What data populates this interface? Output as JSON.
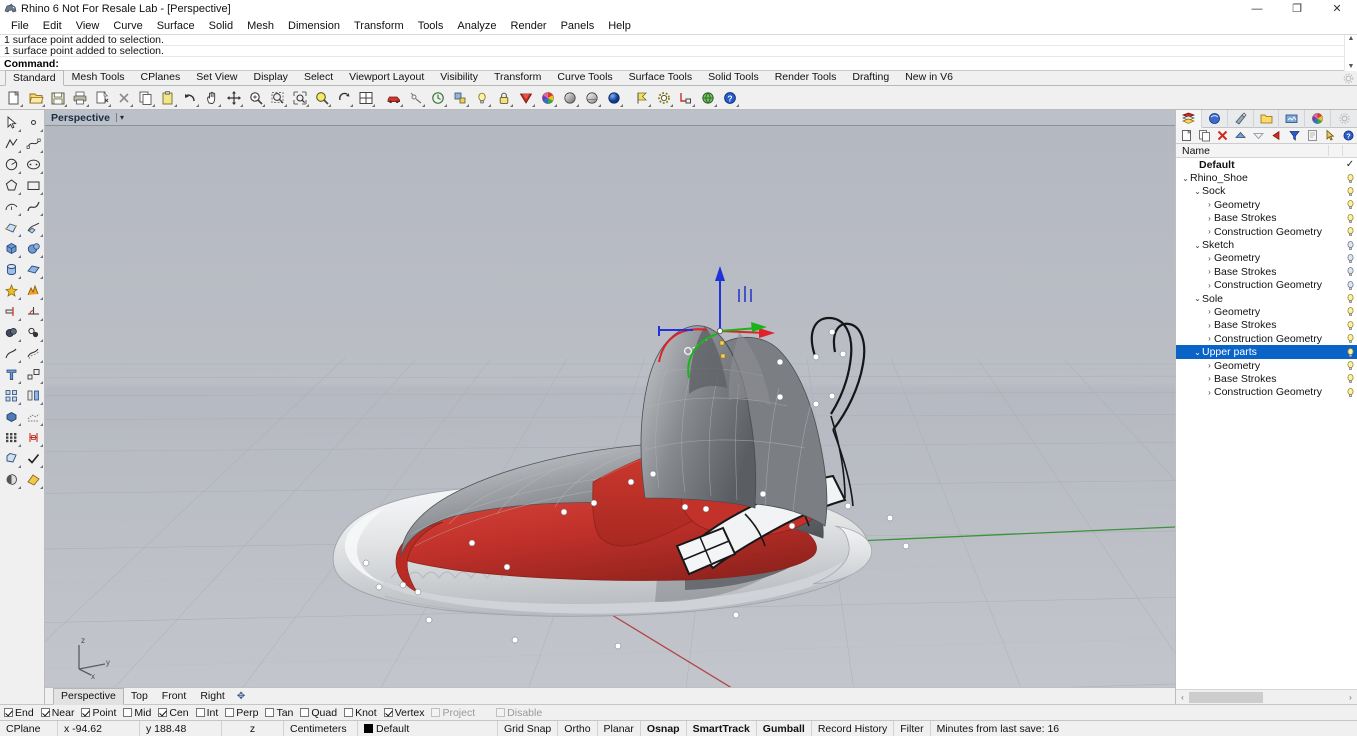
{
  "window": {
    "title": "Rhino 6 Not For Resale Lab - [Perspective]",
    "app_icon": "rhino-icon",
    "minimize": "—",
    "maximize": "❐",
    "close": "✕"
  },
  "menubar": {
    "items": [
      {
        "label": "File"
      },
      {
        "label": "Edit"
      },
      {
        "label": "View"
      },
      {
        "label": "Curve"
      },
      {
        "label": "Surface"
      },
      {
        "label": "Solid"
      },
      {
        "label": "Mesh"
      },
      {
        "label": "Dimension"
      },
      {
        "label": "Transform"
      },
      {
        "label": "Tools"
      },
      {
        "label": "Analyze"
      },
      {
        "label": "Render"
      },
      {
        "label": "Panels"
      },
      {
        "label": "Help"
      }
    ]
  },
  "command_area": {
    "history": [
      "1 surface point added to selection.",
      "1 surface point added to selection."
    ],
    "prompt": "Command:",
    "scroll_up": "▲",
    "scroll_down": "▼"
  },
  "toolbar_tabs": {
    "items": [
      {
        "label": "Standard",
        "active": true
      },
      {
        "label": "Mesh Tools",
        "active": false
      },
      {
        "label": "CPlanes",
        "active": false
      },
      {
        "label": "Set View",
        "active": false
      },
      {
        "label": "Display",
        "active": false
      },
      {
        "label": "Select",
        "active": false
      },
      {
        "label": "Viewport Layout",
        "active": false
      },
      {
        "label": "Visibility",
        "active": false
      },
      {
        "label": "Transform",
        "active": false
      },
      {
        "label": "Curve Tools",
        "active": false
      },
      {
        "label": "Surface Tools",
        "active": false
      },
      {
        "label": "Solid Tools",
        "active": false
      },
      {
        "label": "Render Tools",
        "active": false
      },
      {
        "label": "Drafting",
        "active": false
      },
      {
        "label": "New in V6",
        "active": false
      }
    ],
    "options_icon": "gear-icon"
  },
  "toolbar_icons": [
    {
      "name": "new-file-icon"
    },
    {
      "name": "open-folder-icon"
    },
    {
      "name": "save-icon"
    },
    {
      "name": "print-icon"
    },
    {
      "name": "cut-icon"
    },
    {
      "name": "delete-x-icon"
    },
    {
      "name": "copy-icon"
    },
    {
      "name": "paste-icon"
    },
    {
      "name": "undo-icon"
    },
    {
      "name": "pan-hand-icon"
    },
    {
      "name": "move-icon"
    },
    {
      "name": "zoom-icon"
    },
    {
      "name": "zoom-window-icon"
    },
    {
      "name": "zoom-extents-icon"
    },
    {
      "name": "zoom-selected-icon"
    },
    {
      "name": "rotate-view-icon"
    },
    {
      "name": "viewport-layout-icon"
    },
    {
      "name": "car-render-icon"
    },
    {
      "name": "render-preview-icon"
    },
    {
      "name": "history-icon"
    },
    {
      "name": "properties-icon"
    },
    {
      "name": "layer-bulb-icon"
    },
    {
      "name": "lock-icon"
    },
    {
      "name": "display-shade-icon"
    },
    {
      "name": "color-wheel-icon"
    },
    {
      "name": "shaded-view-icon"
    },
    {
      "name": "ghosted-view-icon"
    },
    {
      "name": "rendered-view-icon"
    },
    {
      "name": "flag-icon"
    },
    {
      "name": "options-gear-icon"
    },
    {
      "name": "named-position-icon"
    },
    {
      "name": "globe-icon"
    },
    {
      "name": "help-icon"
    }
  ],
  "left_palette": [
    {
      "name": "select-arrow-icon"
    },
    {
      "name": "point-icon"
    },
    {
      "name": "polyline-icon"
    },
    {
      "name": "control-point-curve-icon"
    },
    {
      "name": "circle-icon"
    },
    {
      "name": "ellipse-icon"
    },
    {
      "name": "polygon-icon"
    },
    {
      "name": "rectangle-icon"
    },
    {
      "name": "arc-icon"
    },
    {
      "name": "free-curve-icon"
    },
    {
      "name": "surface-from-points-icon"
    },
    {
      "name": "surface-sweep-icon"
    },
    {
      "name": "box-icon"
    },
    {
      "name": "sphere-icon"
    },
    {
      "name": "cylinder-icon"
    },
    {
      "name": "surface-plane-icon"
    },
    {
      "name": "explode-icon"
    },
    {
      "name": "boolean-split-icon"
    },
    {
      "name": "trim-icon"
    },
    {
      "name": "fillet-icon"
    },
    {
      "name": "boolean-union-icon"
    },
    {
      "name": "boolean-difference-icon"
    },
    {
      "name": "offset-curve-icon"
    },
    {
      "name": "offset-surface-icon"
    },
    {
      "name": "transform-icon"
    },
    {
      "name": "scale-icon"
    },
    {
      "name": "array-icon"
    },
    {
      "name": "mirror-icon"
    },
    {
      "name": "cap-solid-icon"
    },
    {
      "name": "mesh-icon"
    },
    {
      "name": "grid-array-icon"
    },
    {
      "name": "dimension-icon"
    },
    {
      "name": "extrude-icon"
    },
    {
      "name": "check-icon"
    },
    {
      "name": "shade-icon"
    },
    {
      "name": "render-material-icon"
    }
  ],
  "viewport": {
    "title": "Perspective",
    "dropdown_arrow": "▾",
    "axis_gizmo": {
      "x": "x",
      "y": "y",
      "z": "z"
    },
    "gumball": {
      "x_axis_color": "#e0202a",
      "y_axis_color": "#19b419",
      "z_axis_color": "#2332d8"
    },
    "background_color": "#b8bbc3",
    "model_colors": {
      "red_strap": "#c6302a",
      "grey_upper": "#8e9196",
      "white_sole": "#e8e9ea",
      "control_point": "#ffffff"
    },
    "tabs": [
      {
        "label": "Perspective",
        "active": true
      },
      {
        "label": "Top",
        "active": false
      },
      {
        "label": "Front",
        "active": false
      },
      {
        "label": "Right",
        "active": false
      }
    ],
    "add_tab": "✥"
  },
  "layer_panel": {
    "tabs": [
      {
        "name": "layers-tab",
        "active": true
      },
      {
        "name": "properties-tab",
        "active": false
      },
      {
        "name": "materials-tab",
        "active": false
      },
      {
        "name": "named-views-tab",
        "active": false
      },
      {
        "name": "display-tab",
        "active": false
      },
      {
        "name": "color-tab",
        "active": false
      },
      {
        "name": "panel-options-tab",
        "active": false
      }
    ],
    "toolbar": [
      {
        "name": "new-layer-icon"
      },
      {
        "name": "new-sublayer-icon"
      },
      {
        "name": "delete-layer-icon"
      },
      {
        "name": "move-up-icon"
      },
      {
        "name": "move-down-icon"
      },
      {
        "name": "set-current-icon"
      },
      {
        "name": "filter-icon"
      },
      {
        "name": "layer-properties-icon"
      },
      {
        "name": "select-objects-icon"
      },
      {
        "name": "layer-help-icon"
      }
    ],
    "header": {
      "name_column": "Name"
    },
    "rows": [
      {
        "label": "Default",
        "indent": 1,
        "twisty": "",
        "bold": true,
        "current": true,
        "bulb": false,
        "selected": false
      },
      {
        "label": "Rhino_Shoe",
        "indent": 0,
        "twisty": "⌄",
        "bold": false,
        "current": false,
        "bulb": true,
        "selected": false
      },
      {
        "label": "Sock",
        "indent": 1,
        "twisty": "⌄",
        "bold": false,
        "current": false,
        "bulb": true,
        "selected": false
      },
      {
        "label": "Geometry",
        "indent": 2,
        "twisty": "›",
        "bold": false,
        "current": false,
        "bulb": true,
        "selected": false
      },
      {
        "label": "Base Strokes",
        "indent": 2,
        "twisty": "›",
        "bold": false,
        "current": false,
        "bulb": true,
        "selected": false
      },
      {
        "label": "Construction Geometry",
        "indent": 2,
        "twisty": "›",
        "bold": false,
        "current": false,
        "bulb": true,
        "selected": false
      },
      {
        "label": "Sketch",
        "indent": 1,
        "twisty": "⌄",
        "bold": false,
        "current": false,
        "bulb": true,
        "selected": false
      },
      {
        "label": "Geometry",
        "indent": 2,
        "twisty": "›",
        "bold": false,
        "current": false,
        "bulb": true,
        "selected": false
      },
      {
        "label": "Base Strokes",
        "indent": 2,
        "twisty": "›",
        "bold": false,
        "current": false,
        "bulb": true,
        "selected": false
      },
      {
        "label": "Construction Geometry",
        "indent": 2,
        "twisty": "›",
        "bold": false,
        "current": false,
        "bulb": true,
        "selected": false
      },
      {
        "label": "Sole",
        "indent": 1,
        "twisty": "⌄",
        "bold": false,
        "current": false,
        "bulb": true,
        "selected": false
      },
      {
        "label": "Geometry",
        "indent": 2,
        "twisty": "›",
        "bold": false,
        "current": false,
        "bulb": true,
        "selected": false
      },
      {
        "label": "Base Strokes",
        "indent": 2,
        "twisty": "›",
        "bold": false,
        "current": false,
        "bulb": true,
        "selected": false
      },
      {
        "label": "Construction Geometry",
        "indent": 2,
        "twisty": "›",
        "bold": false,
        "current": false,
        "bulb": true,
        "selected": false
      },
      {
        "label": "Upper parts",
        "indent": 1,
        "twisty": "⌄",
        "bold": false,
        "current": false,
        "bulb": true,
        "selected": true
      },
      {
        "label": "Geometry",
        "indent": 2,
        "twisty": "›",
        "bold": false,
        "current": false,
        "bulb": true,
        "selected": false
      },
      {
        "label": "Base Strokes",
        "indent": 2,
        "twisty": "›",
        "bold": false,
        "current": false,
        "bulb": true,
        "selected": false
      },
      {
        "label": "Construction Geometry",
        "indent": 2,
        "twisty": "›",
        "bold": false,
        "current": false,
        "bulb": true,
        "selected": false
      }
    ],
    "selection_color": "#0a64c8",
    "scroll_left": "‹",
    "scroll_right": "›"
  },
  "osnap_bar": {
    "items": [
      {
        "label": "End",
        "checked": true,
        "disabled": false
      },
      {
        "label": "Near",
        "checked": true,
        "disabled": false
      },
      {
        "label": "Point",
        "checked": true,
        "disabled": false
      },
      {
        "label": "Mid",
        "checked": false,
        "disabled": false
      },
      {
        "label": "Cen",
        "checked": true,
        "disabled": false
      },
      {
        "label": "Int",
        "checked": false,
        "disabled": false
      },
      {
        "label": "Perp",
        "checked": false,
        "disabled": false
      },
      {
        "label": "Tan",
        "checked": false,
        "disabled": false
      },
      {
        "label": "Quad",
        "checked": false,
        "disabled": false
      },
      {
        "label": "Knot",
        "checked": false,
        "disabled": false
      },
      {
        "label": "Vertex",
        "checked": true,
        "disabled": false
      },
      {
        "label": "Project",
        "checked": false,
        "disabled": true
      },
      {
        "label": "Disable",
        "checked": false,
        "disabled": true
      }
    ]
  },
  "statusbar": {
    "cplane": "CPlane",
    "x": "x -94.62",
    "y": "y 188.48",
    "z": "z",
    "units": "Centimeters",
    "layer": "Default",
    "layer_swatch": "#000000",
    "grid_snap": "Grid Snap",
    "ortho": "Ortho",
    "planar": "Planar",
    "osnap": "Osnap",
    "smarttrack": "SmartTrack",
    "gumball": "Gumball",
    "record_history": "Record History",
    "filter": "Filter",
    "save_msg": "Minutes from last save: 16"
  }
}
